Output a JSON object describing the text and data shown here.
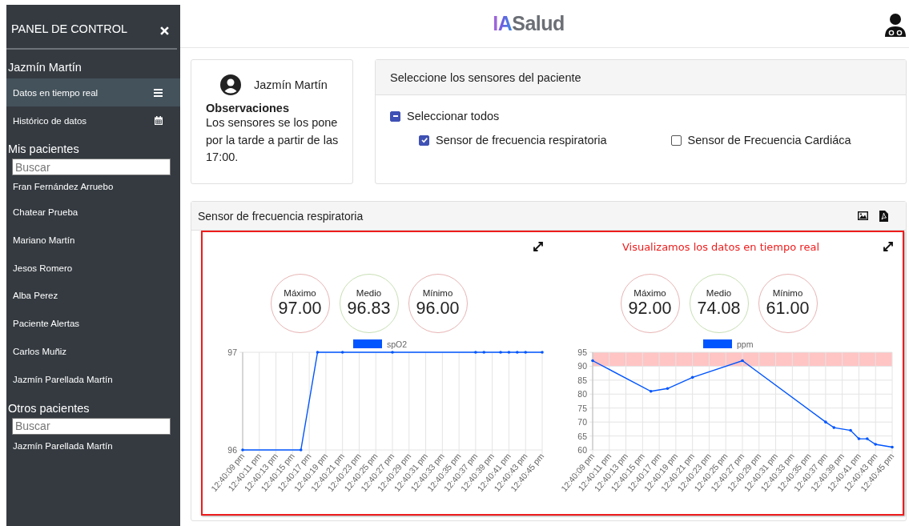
{
  "sidebar": {
    "title": "PANEL DE CONTROL",
    "current_patient": "Jazmín Martín",
    "menu": [
      {
        "label": "Datos en tiempo real",
        "selected": true
      },
      {
        "label": "Histórico de datos",
        "selected": false
      }
    ],
    "sections": [
      {
        "heading": "Mis pacientes",
        "search": {
          "placeholder": "Buscar"
        },
        "patients": [
          "Fran Fernández Arruebo",
          "Chatear Prueba",
          "Mariano Martín",
          "Jesos Romero",
          "Alba Perez",
          "Paciente Alertas",
          "Carlos Muñiz",
          "Jazmín Parellada Martín"
        ]
      },
      {
        "heading": "Otros pacientes",
        "search": {
          "placeholder": "Buscar"
        },
        "patients": [
          "Jazmín Parellada Martín"
        ]
      }
    ]
  },
  "header": {
    "logo": {
      "mark": "IA",
      "name": "Salud"
    }
  },
  "patient_card": {
    "name": "Jazmín Martín",
    "notes_title": "Observaciones",
    "notes": "Los sensores se los pone por la tarde a partir de las 17:00."
  },
  "sensor_card": {
    "title": "Seleccione los sensores del paciente",
    "select_all": {
      "label": "Seleccionar todos",
      "indeterminate": true
    },
    "sensors": [
      {
        "label": "Sensor de frecuencia respiratoria",
        "checked": true
      },
      {
        "label": "Sensor de Frecuencia Cardiáca",
        "checked": false
      }
    ]
  },
  "chart_card": {
    "title": "Sensor de frecuencia respiratoria",
    "note": "Visualizamos los datos en tiempo real",
    "panels": [
      {
        "stats": [
          {
            "label": "Máximo",
            "value": "97.00",
            "color": "#e8b4b4"
          },
          {
            "label": "Medio",
            "value": "96.83",
            "color": "#c8e0b4"
          },
          {
            "label": "Mínimo",
            "value": "96.00",
            "color": "#e8b4b4"
          }
        ],
        "chart_data": {
          "type": "line",
          "categories": [
            "12:40:09 pm",
            null,
            "12:40:11 pm",
            null,
            "12:40:13 pm",
            null,
            "12:40:15 pm",
            null,
            "12:40:17 pm",
            null,
            "12:40:19 pm",
            null,
            "12:40:21 pm",
            null,
            "12:40:23 pm",
            null,
            "12:40:25 pm",
            null,
            "12:40:27 pm",
            null,
            "12:40:29 pm",
            null,
            "12:40:31 pm",
            null,
            "12:40:33 pm",
            null,
            "12:40:35 pm",
            null,
            "12:40:37 pm",
            null,
            "12:40:39 pm",
            null,
            "12:40:41 pm",
            null,
            "12:40:43 pm",
            null,
            "12:40:45 pm"
          ],
          "series": [
            {
              "name": "spO2",
              "color": "#0055ff",
              "values": [
                96,
                null,
                null,
                null,
                null,
                null,
                null,
                96,
                null,
                97,
                null,
                null,
                97,
                null,
                null,
                null,
                null,
                null,
                97,
                null,
                null,
                null,
                null,
                null,
                null,
                null,
                null,
                null,
                97,
                97,
                null,
                97,
                97,
                97,
                97,
                null,
                97
              ]
            }
          ],
          "ylim": [
            96,
            97
          ],
          "yticks": [
            96,
            97
          ],
          "grid": true
        }
      },
      {
        "stats": [
          {
            "label": "Máximo",
            "value": "92.00",
            "color": "#e8b4b4"
          },
          {
            "label": "Medio",
            "value": "74.08",
            "color": "#c8e0b4"
          },
          {
            "label": "Mínimo",
            "value": "61.00",
            "color": "#e8b4b4"
          }
        ],
        "chart_data": {
          "type": "line",
          "categories": [
            "12:40:09 pm",
            null,
            "12:40:11 pm",
            null,
            "12:40:13 pm",
            null,
            "12:40:15 pm",
            null,
            "12:40:17 pm",
            null,
            "12:40:19 pm",
            null,
            "12:40:21 pm",
            null,
            "12:40:23 pm",
            null,
            "12:40:25 pm",
            null,
            "12:40:27 pm",
            null,
            "12:40:29 pm",
            null,
            "12:40:31 pm",
            null,
            "12:40:33 pm",
            null,
            "12:40:35 pm",
            null,
            "12:40:37 pm",
            null,
            "12:40:39 pm",
            null,
            "12:40:41 pm",
            null,
            "12:40:43 pm",
            null,
            "12:40:45 pm"
          ],
          "series": [
            {
              "name": "ppm",
              "color": "#0055ff",
              "values": [
                92,
                null,
                null,
                null,
                null,
                null,
                null,
                81,
                null,
                82,
                null,
                null,
                86,
                null,
                null,
                null,
                null,
                null,
                92,
                null,
                null,
                null,
                null,
                null,
                null,
                null,
                null,
                null,
                70,
                68,
                null,
                67,
                64,
                64,
                62,
                null,
                61
              ]
            }
          ],
          "ylim": [
            60,
            95
          ],
          "yticks": [
            60,
            65,
            70,
            75,
            80,
            85,
            90,
            95
          ],
          "grid": true,
          "bands": [
            {
              "axis": "y",
              "from": 90,
              "to": 95,
              "color": "#ffc4c4"
            }
          ]
        }
      }
    ]
  }
}
